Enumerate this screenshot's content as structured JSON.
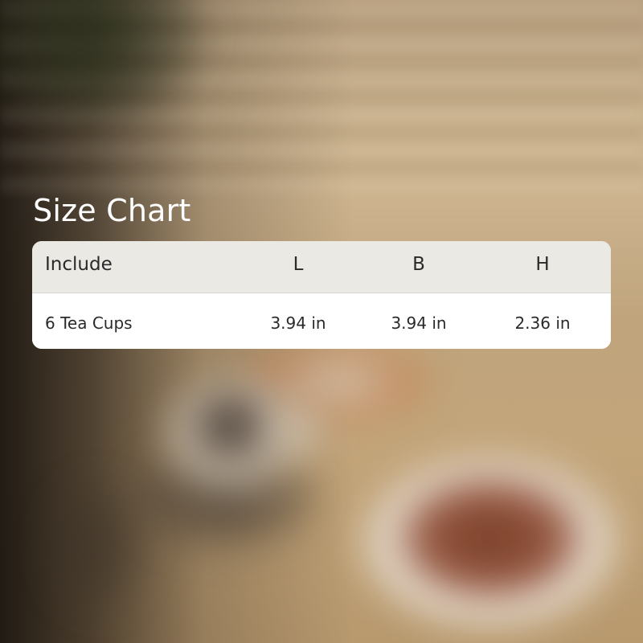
{
  "title": "Size Chart",
  "table": {
    "headers": [
      "Include",
      "L",
      "B",
      "H"
    ],
    "rows": [
      [
        "6 Tea Cups",
        "3.94 in",
        "3.94 in",
        "2.36 in"
      ]
    ]
  },
  "colors": {
    "title_text": "#ffffff",
    "header_bg": "#ebe9e4",
    "row_bg": "#ffffff",
    "cell_text": "#2a2a2a"
  }
}
